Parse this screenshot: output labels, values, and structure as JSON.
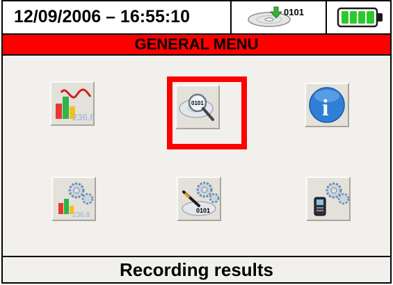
{
  "header": {
    "datetime": "12/09/2006 – 16:55:10",
    "disk_label": "0101",
    "disk_icon": "memory-disk-download-icon",
    "battery_icon": "battery-full-icon",
    "battery_level": 1.0
  },
  "menu": {
    "title": "GENERAL MENU",
    "items": [
      {
        "icon": "real-time-values-icon",
        "digits": "236.8"
      },
      {
        "icon": "recording-results-icon",
        "digits": "0101",
        "selected": true
      },
      {
        "icon": "info-icon",
        "glyph": "i"
      },
      {
        "icon": "analyzer-settings-icon",
        "digits": "236.8"
      },
      {
        "icon": "recording-settings-icon",
        "digits": "0101"
      },
      {
        "icon": "meter-settings-icon"
      }
    ]
  },
  "footer": {
    "status": "Recording results"
  },
  "colors": {
    "title_bar": "#ff0000",
    "selection": "#ff0000",
    "battery_green": "#2cc92c",
    "info_blue": "#2f7fd6"
  }
}
